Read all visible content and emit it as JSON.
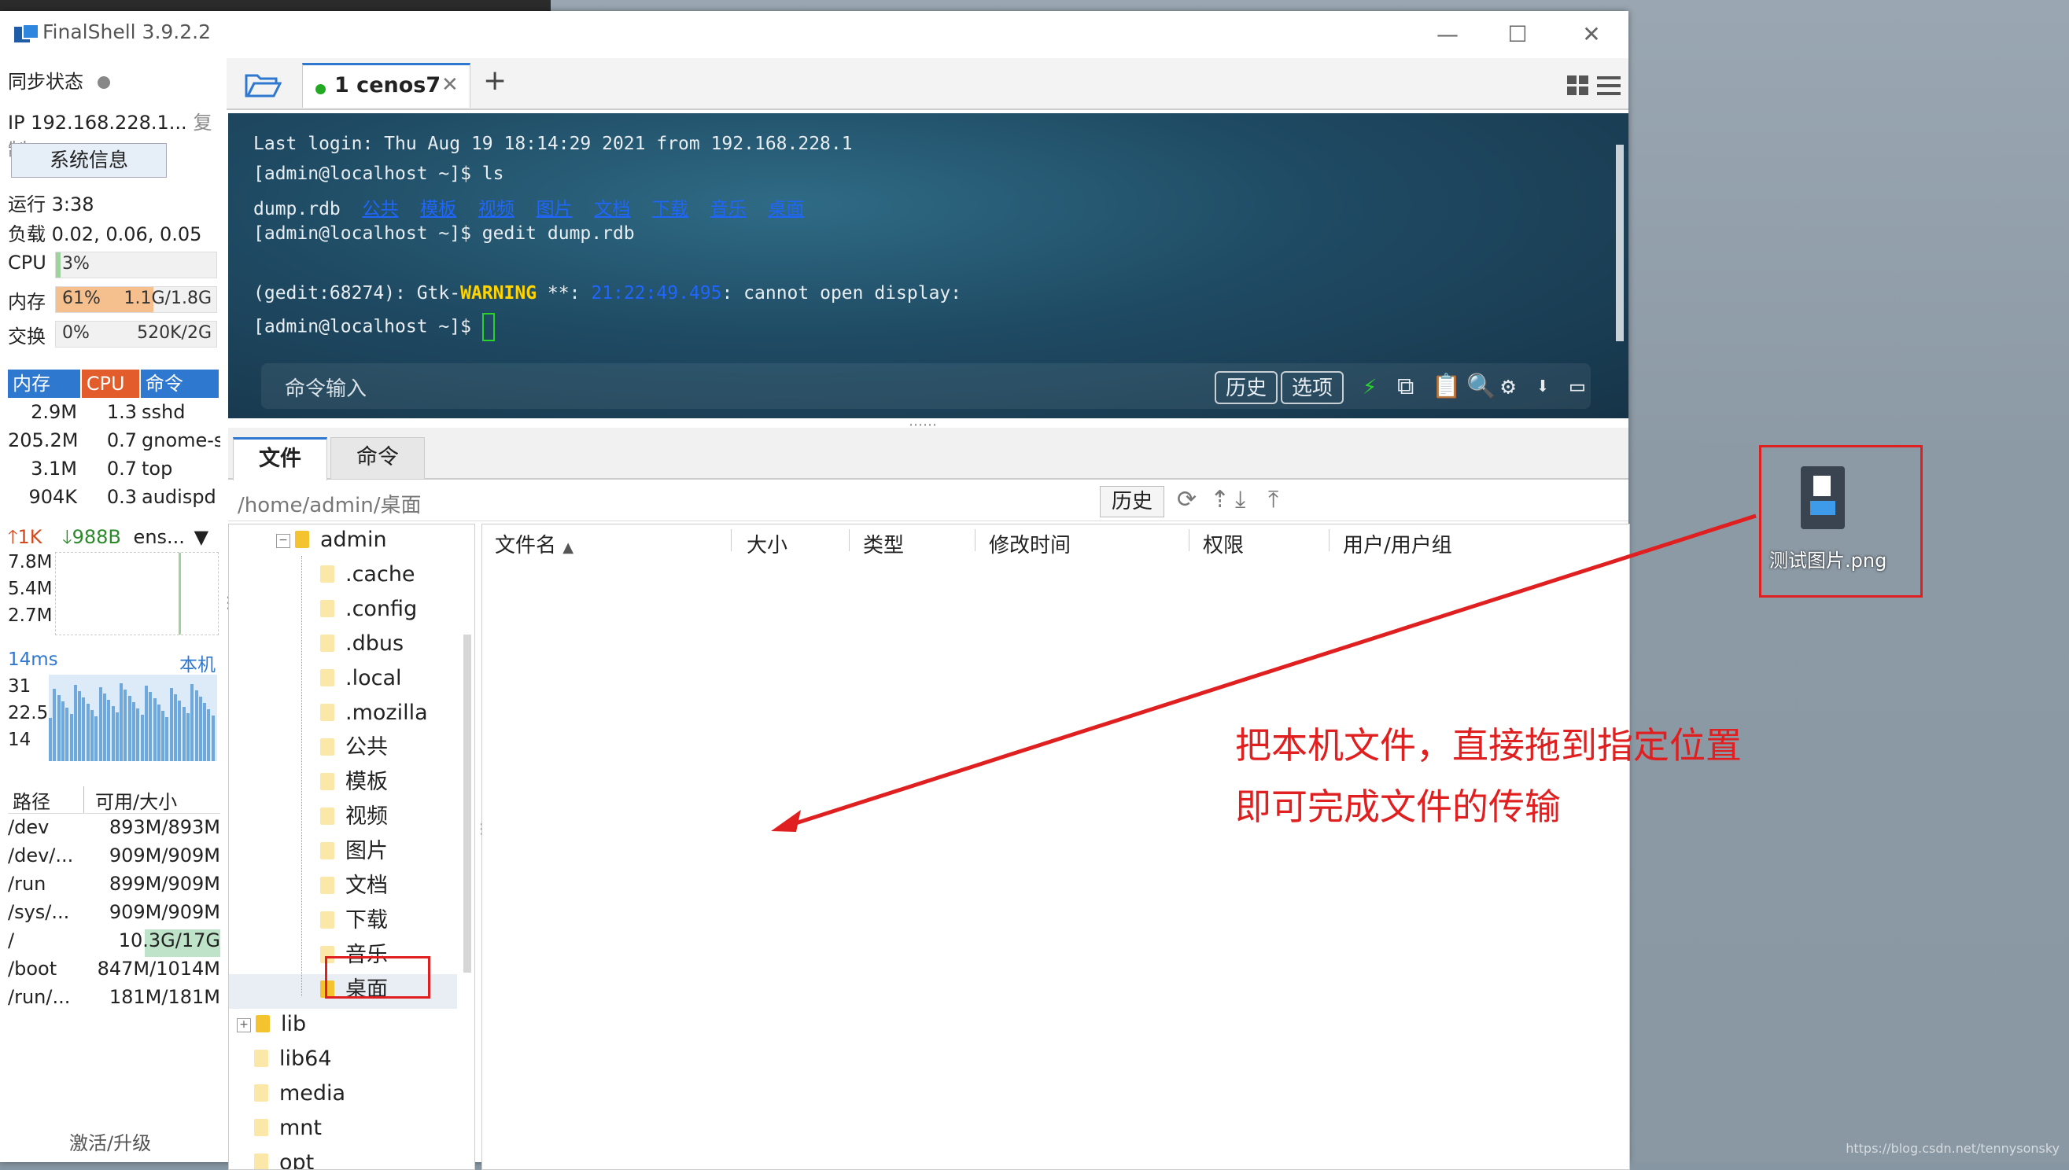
{
  "window": {
    "title": "FinalShell 3.9.2.2",
    "minimize": "—",
    "maximize": "☐",
    "close": "✕"
  },
  "left": {
    "sync_label": "同步状态",
    "ip": "IP 192.168.228.1...",
    "copy": "复制",
    "sysinfo": "系统信息",
    "uptime": "运行 3:38",
    "load": "负载 0.02, 0.06, 0.05",
    "cpu_label": "CPU",
    "cpu_pct": "3%",
    "cpu_level": 0.03,
    "mem_label": "内存",
    "mem_pct": "61%",
    "mem_size": "1.1G/1.8G",
    "mem_level": 0.61,
    "swap_label": "交换",
    "swap_pct": "0%",
    "swap_size": "520K/2G",
    "proc_headers": [
      "内存",
      "CPU",
      "命令"
    ],
    "procs": [
      {
        "mem": "2.9M",
        "cpu": "1.3",
        "cmd": "sshd"
      },
      {
        "mem": "205.2M",
        "cpu": "0.7",
        "cmd": "gnome-s"
      },
      {
        "mem": "3.1M",
        "cpu": "0.7",
        "cmd": "top"
      },
      {
        "mem": "904K",
        "cpu": "0.3",
        "cmd": "audispd"
      }
    ],
    "net_up": "1K",
    "net_down": "988B",
    "net_iface": "ens...",
    "net_scale": [
      "7.8M",
      "5.4M",
      "2.7M"
    ],
    "ping_ms": "14ms",
    "ping_target": "本机",
    "ping_scale": [
      "31",
      "22.5",
      "14"
    ],
    "disk_headers": [
      "路径",
      "可用/大小"
    ],
    "disks": [
      {
        "path": "/dev",
        "size": "893M/893M"
      },
      {
        "path": "/dev/...",
        "size": "909M/909M"
      },
      {
        "path": "/run",
        "size": "899M/909M"
      },
      {
        "path": "/sys/...",
        "size": "909M/909M"
      },
      {
        "path": "/",
        "size": "10.3G/17G"
      },
      {
        "path": "/boot",
        "size": "847M/1014M"
      },
      {
        "path": "/run/...",
        "size": "181M/181M"
      }
    ],
    "activate": "激活/升级"
  },
  "tabs": {
    "session": "1 cenos7",
    "add": "+"
  },
  "terminal": {
    "line1": "Last login: Thu Aug 19 18:14:29 2021 from 192.168.228.1",
    "line2": "[admin@localhost ~]$ ls",
    "ls_file": "dump.rdb",
    "ls_dirs": [
      "公共",
      "模板",
      "视频",
      "图片",
      "文档",
      "下载",
      "音乐",
      "桌面"
    ],
    "line4": "[admin@localhost ~]$ gedit dump.rdb",
    "warn_prefix": "(gedit:68274): Gtk-",
    "warn_word": "WARNING",
    "warn_mid": " **: ",
    "warn_time": "21:22:49.495",
    "warn_suffix": ": cannot open display:",
    "prompt": "[admin@localhost ~]$ ",
    "cmd_input_placeholder": "命令输入",
    "history_btn": "历史",
    "options_btn": "选项"
  },
  "files": {
    "tab_files": "文件",
    "tab_commands": "命令",
    "path": "/home/admin/桌面",
    "history_btn": "历史",
    "tree": {
      "admin": "admin",
      "children": [
        ".cache",
        ".config",
        ".dbus",
        ".local",
        ".mozilla",
        "公共",
        "模板",
        "视频",
        "图片",
        "文档",
        "下载",
        "音乐",
        "桌面"
      ],
      "root_items": [
        "lib",
        "lib64",
        "media",
        "mnt",
        "opt"
      ]
    },
    "columns": [
      "文件名",
      "大小",
      "类型",
      "修改时间",
      "权限",
      "用户/用户组"
    ]
  },
  "annotation": {
    "line1": "把本机文件，直接拖到指定位置",
    "line2": "即可完成文件的传输"
  },
  "desktop": {
    "file_name": "测试图片.png",
    "watermark": "https://blog.csdn.net/tennysonsky"
  },
  "colors": {
    "accent": "#2f78d0",
    "annotation_red": "#e02020",
    "terminal_bg": "#1f4a63",
    "dir_blue": "#1e66ff",
    "warning_yellow": "#ffd400"
  }
}
